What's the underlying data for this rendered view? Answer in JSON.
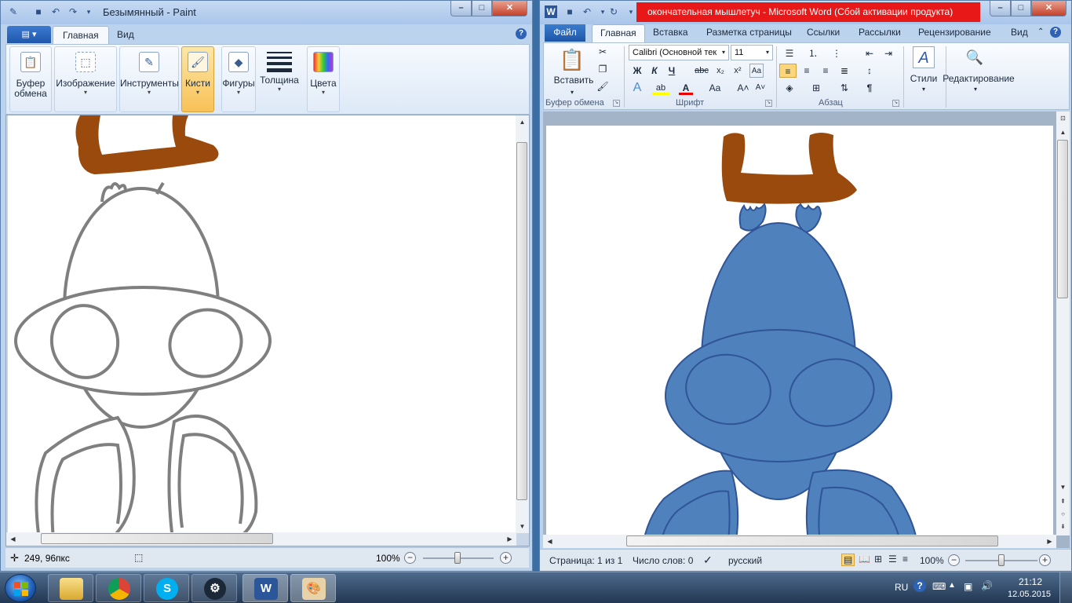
{
  "paint": {
    "title": "Безымянный - Paint",
    "tabs": [
      "Главная",
      "Вид"
    ],
    "file_menu": "▤ ▾",
    "help": "?",
    "groups": [
      {
        "label1": "Буфер",
        "label2": "обмена",
        "icon": "clipboard-icon"
      },
      {
        "label1": "Изображение",
        "label2": "",
        "icon": "select-icon"
      },
      {
        "label1": "Инструменты",
        "label2": "",
        "icon": "tools-icon"
      },
      {
        "label1": "Кисти",
        "label2": "",
        "icon": "brush-icon",
        "selected": true
      },
      {
        "label1": "Фигуры",
        "label2": "",
        "icon": "shapes-icon"
      },
      {
        "label1": "Толщина",
        "label2": "",
        "icon": "thickness-icon"
      },
      {
        "label1": "Цвета",
        "label2": "",
        "icon": "palette-icon"
      }
    ],
    "status": {
      "cursor_pos": "249, 96пкс",
      "zoom": "100%",
      "zoom_level_pct": 100
    }
  },
  "word": {
    "title": "окончательная мышлетуч  -  Microsoft Word (Сбой активации продукта)",
    "tabs": [
      "Файл",
      "Главная",
      "Вставка",
      "Разметка страницы",
      "Ссылки",
      "Рассылки",
      "Рецензирование",
      "Вид"
    ],
    "clipboard": {
      "paste": "Вставить",
      "group": "Буфер обмена"
    },
    "font": {
      "name": "Calibri (Основной тек",
      "size": "11",
      "group": "Шрифт"
    },
    "paragraph": {
      "group": "Абзац"
    },
    "styles": {
      "label": "Стили"
    },
    "editing": {
      "label": "Редактирование"
    },
    "status": {
      "page": "Страница: 1 из 1",
      "words": "Число слов: 0",
      "language": "русский",
      "zoom": "100%"
    }
  },
  "drawing": {
    "outline_color": "#7f7f7f",
    "antlers_color": "#9a4a0c",
    "body_color": "#4f81bd",
    "body_stroke": "#2f5597"
  },
  "taskbar": {
    "apps": [
      "explorer-icon",
      "chrome-icon",
      "skype-icon",
      "steam-icon",
      "word-icon",
      "paint-icon"
    ],
    "lang": "RU",
    "time": "21:12",
    "date": "12.05.2015"
  }
}
